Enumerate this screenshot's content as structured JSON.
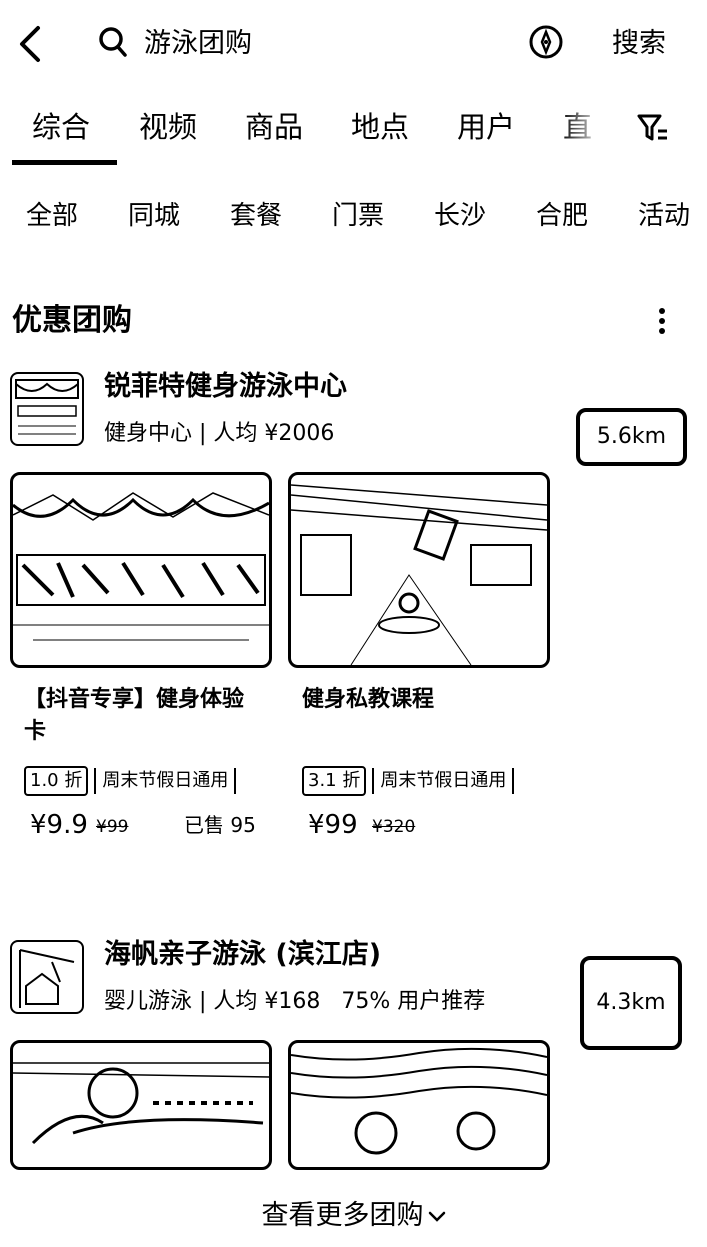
{
  "topbar": {
    "back_icon": "chevron-left-icon",
    "search_icon": "search-icon",
    "query": "游泳团购",
    "compass_icon": "compass-icon",
    "search_label": "搜索"
  },
  "tabs": [
    "综合",
    "视频",
    "商品",
    "地点",
    "用户",
    "直"
  ],
  "active_tab": "综合",
  "filter_icon": "filter-icon",
  "chips": [
    "全部",
    "同城",
    "套餐",
    "门票",
    "长沙",
    "合肥",
    "活动"
  ],
  "section": {
    "title": "优惠团购",
    "more_icon": "more-vertical-icon"
  },
  "shops": [
    {
      "name": "锐菲特健身游泳中心",
      "meta": "健身中心 | 人均 ¥2006",
      "distance": "5.6km",
      "deals": [
        {
          "title": "【抖音专享】健身体验卡",
          "discount": "1.0 折",
          "usage": "周末节假日通用",
          "price": "¥9.9",
          "original": "¥99",
          "sold": "已售 95"
        },
        {
          "title": "健身私教课程",
          "discount": "3.1 折",
          "usage": "周末节假日通用",
          "price": "¥99",
          "original": "¥320",
          "sold": ""
        }
      ]
    },
    {
      "name": "海帆亲子游泳 (滨江店)",
      "meta": "婴儿游泳 | 人均 ¥168",
      "recommend": "75% 用户推荐",
      "distance": "4.3km"
    }
  ],
  "footer": {
    "more_label": "查看更多团购",
    "chevron_icon": "chevron-down-icon"
  }
}
